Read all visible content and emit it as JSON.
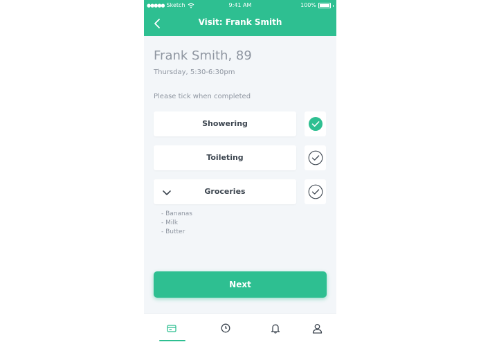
{
  "status_bar": {
    "carrier": "Sketch",
    "time": "9:41 AM",
    "battery": "100%"
  },
  "nav": {
    "title": "Visit: Frank Smith",
    "back_icon": "chevron-left-icon"
  },
  "patient": {
    "name_age": "Frank Smith, 89",
    "visit_time": "Thursday, 5:30-6:30pm"
  },
  "instruction": "Please tick when completed",
  "tasks": [
    {
      "label": "Showering",
      "completed": true
    },
    {
      "label": "Toileting",
      "completed": false
    },
    {
      "label": "Groceries",
      "completed": false,
      "expanded": true
    }
  ],
  "grocery_items": [
    "- Bananas",
    "- Milk",
    "- Butter"
  ],
  "next_button": "Next",
  "tabs": [
    {
      "icon": "card-icon",
      "active": true
    },
    {
      "icon": "clock-icon",
      "active": false
    },
    {
      "icon": "bell-icon",
      "active": false
    },
    {
      "icon": "user-icon",
      "active": false
    }
  ],
  "colors": {
    "accent": "#2ebf91",
    "background": "#f3f6f9",
    "muted_text": "#8e95a0",
    "dark_text": "#3d4650"
  }
}
